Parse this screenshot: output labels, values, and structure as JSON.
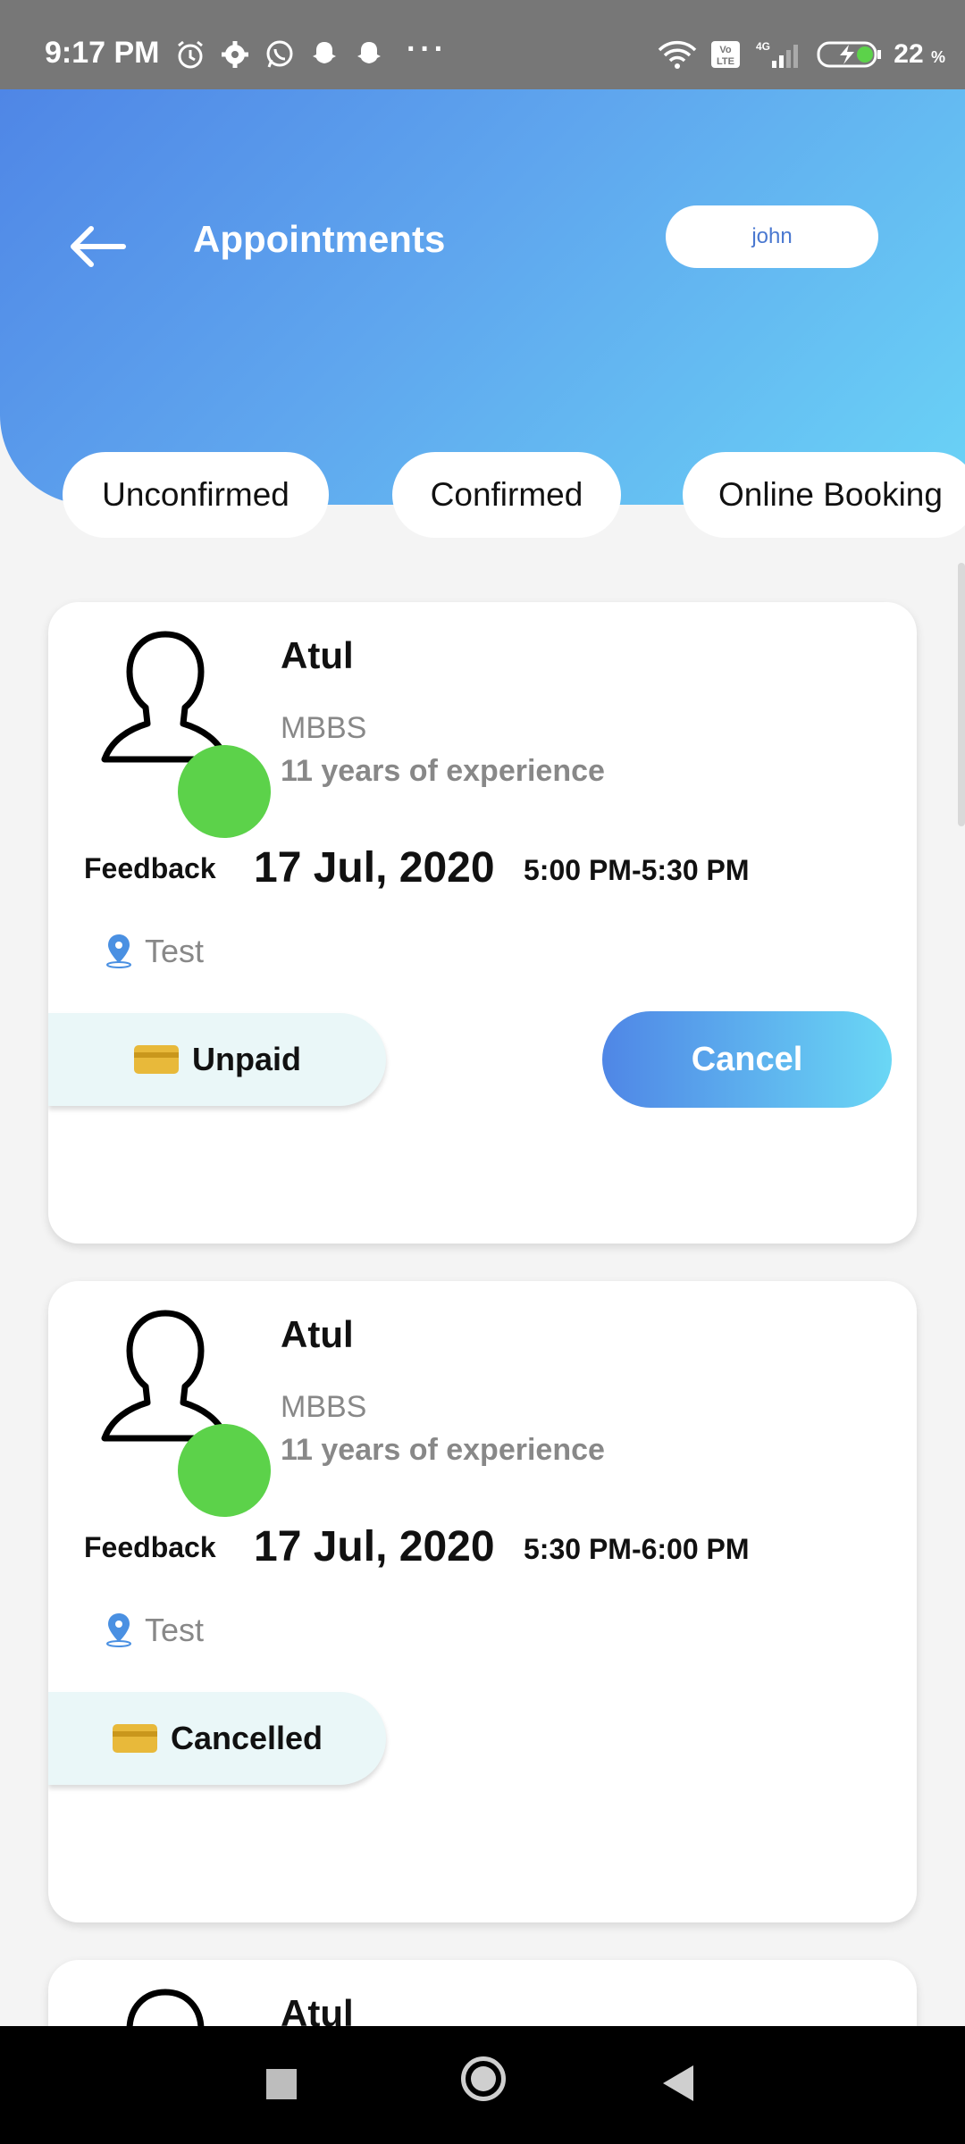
{
  "status_bar": {
    "time": "9:17 PM",
    "dots": "···",
    "battery_percent": "22",
    "battery_unit": "%",
    "icons": [
      "alarm-icon",
      "settings-icon",
      "whatsapp-icon",
      "snapchat-icon",
      "snapchat-icon",
      "wifi-icon",
      "volte-icon",
      "4g-signal-icon",
      "battery-charging-icon"
    ]
  },
  "header": {
    "title": "Appointments",
    "user": "john",
    "gradient": [
      "#4f86e6",
      "#6ad3f6"
    ]
  },
  "tabs": [
    {
      "label": "Unconfirmed"
    },
    {
      "label": "Confirmed"
    },
    {
      "label": "Online Booking"
    }
  ],
  "appointments": [
    {
      "doctor": "Atul",
      "degree": "MBBS",
      "experience": "11 years of experience",
      "feedback": "Feedback",
      "date": "17 Jul, 2020",
      "time": "5:00 PM-5:30 PM",
      "location": "Test",
      "payment_status": "Unpaid",
      "action": "Cancel"
    },
    {
      "doctor": "Atul",
      "degree": "MBBS",
      "experience": "11 years of experience",
      "feedback": "Feedback",
      "date": "17 Jul, 2020",
      "time": "5:30 PM-6:00 PM",
      "location": "Test",
      "payment_status": "Cancelled"
    },
    {
      "doctor": "Atul"
    }
  ],
  "colors": {
    "online": "#5cd24a",
    "accent": "#4f86e6",
    "card_icon": "#e8b93a"
  }
}
